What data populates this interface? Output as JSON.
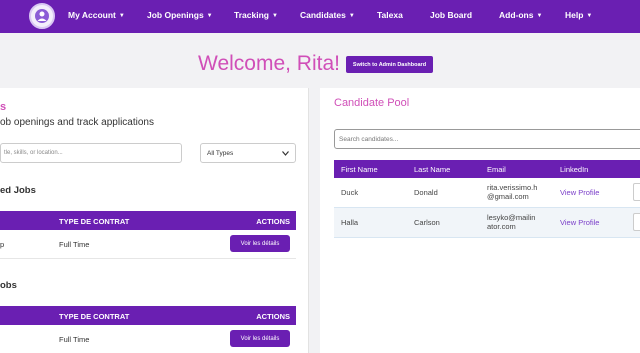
{
  "nav": {
    "items": [
      {
        "label": "My Account",
        "caret": true
      },
      {
        "label": "Job Openings",
        "caret": true
      },
      {
        "label": "Tracking",
        "caret": true
      },
      {
        "label": "Candidates",
        "caret": true
      },
      {
        "label": "Talexa",
        "caret": false
      },
      {
        "label": "Job Board",
        "caret": false
      },
      {
        "label": "Add-ons",
        "caret": true
      },
      {
        "label": "Help",
        "caret": true
      }
    ],
    "caret_glyph": "▼"
  },
  "welcome": {
    "greeting": "Welcome, Rita!",
    "admin_button": "Switch to Admin Dashboard"
  },
  "left": {
    "heading": "s",
    "subtitle": "ob openings and track applications",
    "search_placeholder": "tle, skills, or location...",
    "type_filter": "All Types",
    "sections": [
      {
        "title": "ed Jobs",
        "headers": [
          "TYPE DE CONTRAT",
          "ACTIONS"
        ],
        "rows": [
          {
            "partial": "p",
            "type": "Full Time",
            "action": "Voir les détails"
          }
        ]
      },
      {
        "title": "obs",
        "headers": [
          "TYPE DE CONTRAT",
          "ACTIONS"
        ],
        "rows": [
          {
            "partial": "",
            "type": "Full Time",
            "action": "Voir les détails"
          }
        ]
      }
    ]
  },
  "pool": {
    "title": "Candidate Pool",
    "search_placeholder": "Search candidates...",
    "headers": [
      "First Name",
      "Last Name",
      "Email",
      "LinkedIn"
    ],
    "rows": [
      {
        "first": "Duck",
        "last": "Donald",
        "email": "rita.verissimo.h\n@gmail.com",
        "linkedin": "View Profile"
      },
      {
        "first": "Halla",
        "last": "Carlson",
        "email": "lesyko@mailin\nator.com",
        "linkedin": "View Profile"
      }
    ]
  },
  "colors": {
    "primary": "#6a1fb2",
    "accent": "#d04fb8",
    "link": "#7b3fc9"
  }
}
